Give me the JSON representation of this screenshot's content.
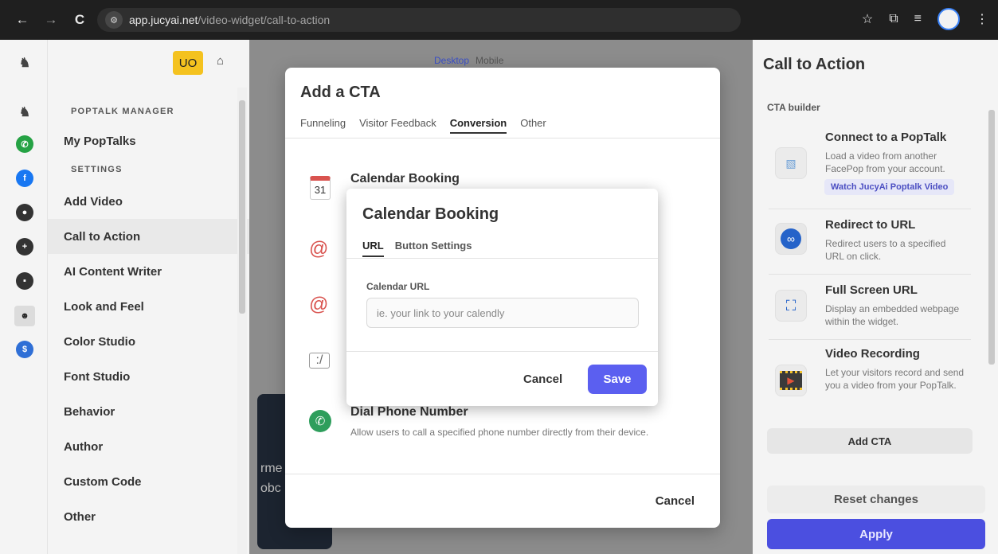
{
  "browser": {
    "back_glyph": "←",
    "forward_glyph": "→",
    "reload_glyph": "C",
    "url_host": "app.jucyai.net",
    "url_path": "/video-widget/call-to-action",
    "star_glyph": "☆",
    "extensions_glyph": "⧉",
    "playlist_glyph": "≡",
    "menu_glyph": "⋮"
  },
  "rail": {
    "icons": [
      "logo-icon",
      "poptalk-manager-icon",
      "whatsapp-icon",
      "facebook-icon",
      "user-circle-icon",
      "plus-circle-icon",
      "box-circle-icon",
      "mascot-icon",
      "dollar-circle-icon"
    ]
  },
  "sidebar": {
    "user_initials": "UO",
    "home_glyph": "⌂",
    "section_manager": "POPTALK MANAGER",
    "my_poptalks": "My PopTalks",
    "section_settings": "SETTINGS",
    "items": [
      {
        "label": "Add Video"
      },
      {
        "label": "Call to Action"
      },
      {
        "label": "AI Content Writer"
      },
      {
        "label": "Look and Feel"
      },
      {
        "label": "Color Studio"
      },
      {
        "label": "Font Studio"
      },
      {
        "label": "Behavior"
      },
      {
        "label": "Author"
      },
      {
        "label": "Custom Code"
      },
      {
        "label": "Other"
      }
    ]
  },
  "workspace": {
    "toggle_desktop": "Desktop",
    "toggle_mobile": "Mobile",
    "preview_text_1": "rme",
    "preview_text_2": "obc"
  },
  "cta_modal": {
    "title": "Add a CTA",
    "tabs": [
      "Funneling",
      "Visitor Feedback",
      "Conversion",
      "Other"
    ],
    "active_tab": "Conversion",
    "rows": [
      {
        "title": "Calendar Booking",
        "icon": "calendar-icon",
        "icon_text": "31"
      },
      {
        "title": "",
        "icon": "at-icon"
      },
      {
        "title": "",
        "icon": "at-icon"
      },
      {
        "title": "",
        "icon": "url-icon"
      },
      {
        "title": "Dial Phone Number",
        "description": "Allow users to call a specified phone number directly from their device.",
        "icon": "phone-icon"
      }
    ],
    "cancel_label": "Cancel"
  },
  "calendar_dialog": {
    "title": "Calendar Booking",
    "tabs": [
      "URL",
      "Button Settings"
    ],
    "active_tab": "URL",
    "field_label": "Calendar URL",
    "field_placeholder": "ie. your link to your calendly",
    "field_value": "",
    "cancel_label": "Cancel",
    "save_label": "Save",
    "accent": "#5b5ff0"
  },
  "right_panel": {
    "title": "Call to Action",
    "subtitle": "CTA builder",
    "items": [
      {
        "title": "Connect to a PopTalk",
        "description": "Load a video from another FacePop from your account.",
        "link": "Watch JucyAi Poptalk Video",
        "icon": "broken-image-icon"
      },
      {
        "title": "Redirect to URL",
        "description": "Redirect users to a specified URL on click.",
        "icon": "link-icon"
      },
      {
        "title": "Full Screen URL",
        "description": "Display an embedded webpage within the widget.",
        "icon": "fullscreen-icon"
      },
      {
        "title": "Video Recording",
        "description": "Let your visitors record and send you a video from your PopTalk.",
        "icon": "video-record-icon"
      }
    ],
    "add_cta_label": "Add CTA",
    "reset_label": "Reset changes",
    "apply_label": "Apply",
    "apply_color": "#4b4fe0"
  }
}
